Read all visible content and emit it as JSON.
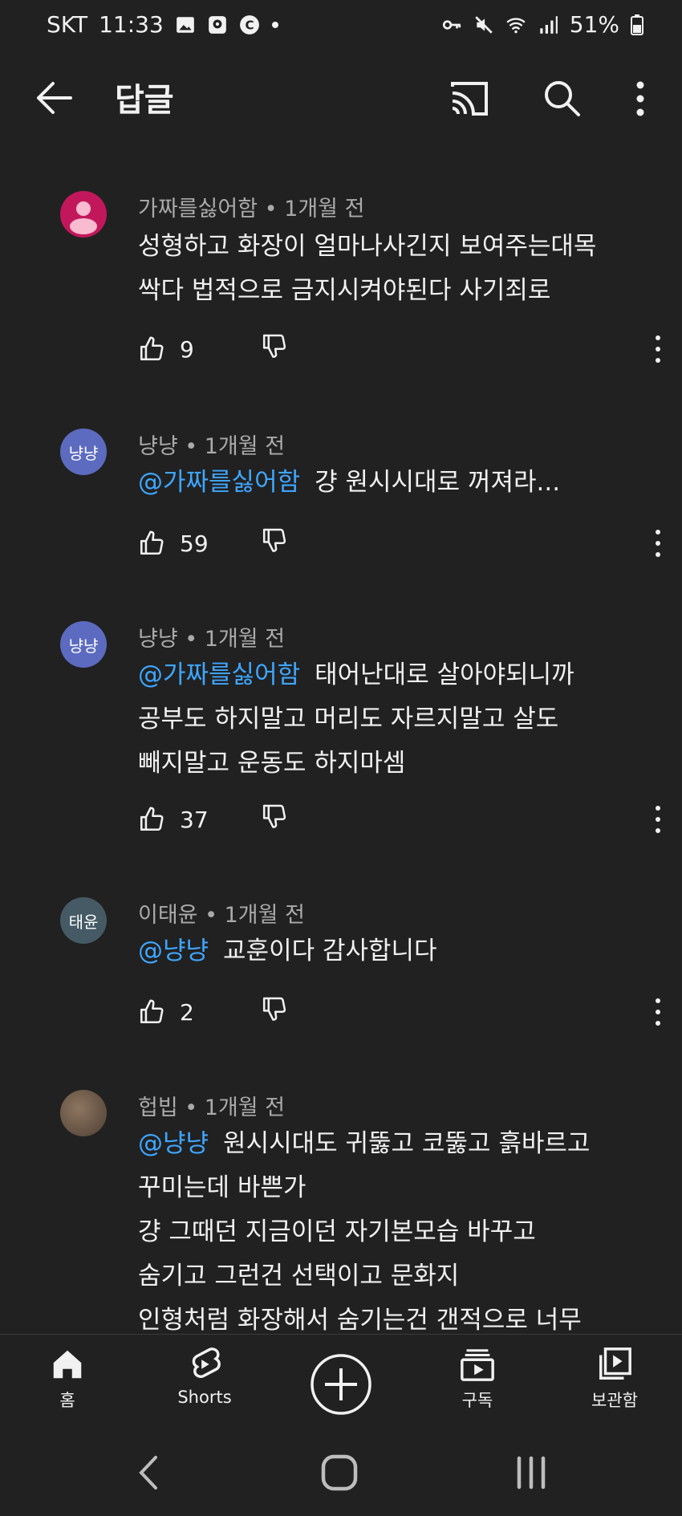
{
  "status_bar": {
    "carrier": "SKT",
    "time": "11:33",
    "battery": "51%"
  },
  "app_bar": {
    "title": "답글"
  },
  "comments": [
    {
      "author": "가짜를싫어함",
      "time": "1개월 전",
      "avatar_text": "",
      "avatar_color": "#c2185b",
      "mention": "",
      "lines": [
        "성형하고 화장이 얼마나사긴지 보여주는대목",
        "싹다 법적으로 금지시켜야된다 사기죄로"
      ],
      "likes": "9"
    },
    {
      "author": "냥냥",
      "time": "1개월 전",
      "avatar_text": "냥냥",
      "avatar_color": "#5c6bc0",
      "mention": "@가짜를싫어함",
      "lines": [
        "걍 원시시대로 꺼져라..."
      ],
      "likes": "59"
    },
    {
      "author": "냥냥",
      "time": "1개월 전",
      "avatar_text": "냥냥",
      "avatar_color": "#5c6bc0",
      "mention": "@가짜를싫어함",
      "lines": [
        "태어난대로 살아야되니까",
        "공부도 하지말고 머리도 자르지말고 살도",
        "빼지말고 운동도 하지마셈"
      ],
      "likes": "37"
    },
    {
      "author": "이태윤",
      "time": "1개월 전",
      "avatar_text": "태윤",
      "avatar_color": "#455a64",
      "mention": "@냥냥",
      "lines": [
        "교훈이다 감사합니다"
      ],
      "likes": "2"
    },
    {
      "author": "헙빕",
      "time": "1개월 전",
      "avatar_text": "",
      "avatar_color": "#6d5a48",
      "mention": "@냥냥",
      "lines": [
        "원시시대도 귀뚫고 코뚫고 흙바르고",
        "꾸미는데 바쁜가",
        "걍 그때던 지금이던 자기본모습 바꾸고",
        "숨기고 그런건 선택이고 문화지",
        "인형처럼 화장해서 숨기는건 갠적으로 너무"
      ],
      "likes": ""
    }
  ],
  "bottom_nav": {
    "home": "홈",
    "shorts": "Shorts",
    "subscriptions": "구독",
    "library": "보관함"
  },
  "icons": {
    "back": "arrow-left-icon",
    "cast": "cast-icon",
    "search": "search-icon",
    "more": "more-vert-icon",
    "like": "thumb-up-icon",
    "dislike": "thumb-down-icon"
  }
}
